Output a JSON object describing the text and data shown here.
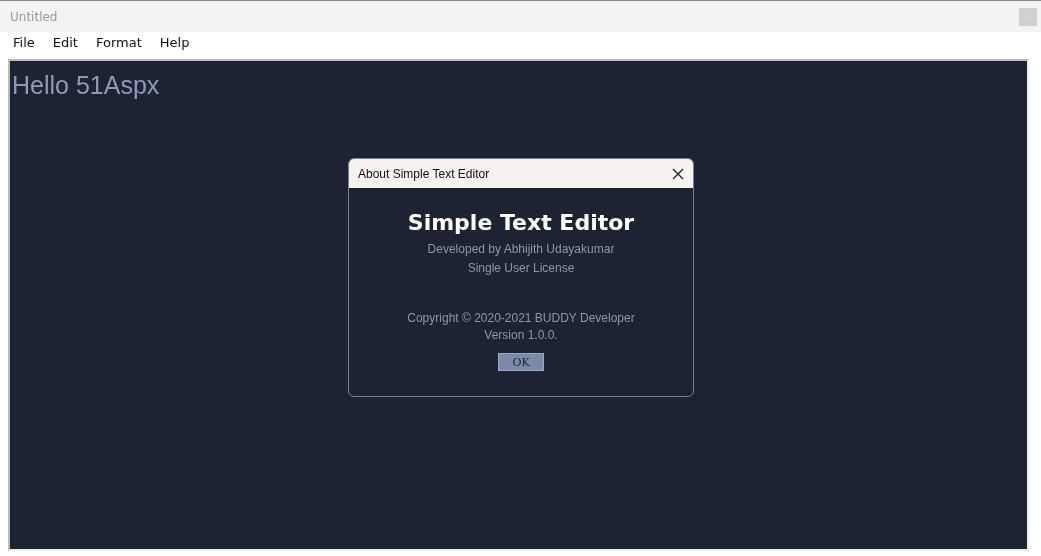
{
  "window": {
    "title": "Untitled"
  },
  "menu": [
    "File",
    "Edit",
    "Format",
    "Help"
  ],
  "editor": {
    "text": "Hello 51Aspx"
  },
  "dialog": {
    "title": "About Simple Text Editor",
    "heading": "Simple Text Editor",
    "lines": [
      "Developed by Abhijith Udayakumar",
      "Single User License"
    ],
    "copyright": "Copyright © 2020-2021 BUDDY Developer",
    "version": "Version 1.0.0.",
    "button": "OK"
  }
}
